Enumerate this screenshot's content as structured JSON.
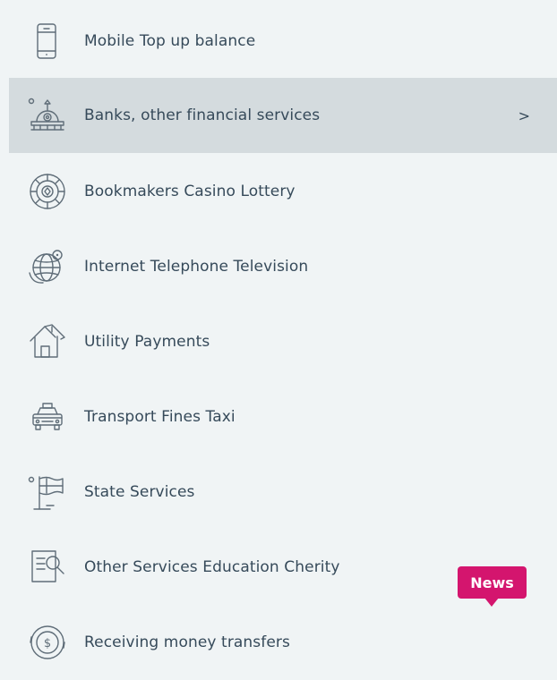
{
  "menu": {
    "items": [
      {
        "label": "Mobile Top up balance",
        "icon": "mobile-phone-icon"
      },
      {
        "label": "Banks, other financial services",
        "icon": "bank-icon",
        "selected": true,
        "chevron": ">"
      },
      {
        "label": "Bookmakers Casino Lottery",
        "icon": "casino-chip-icon"
      },
      {
        "label": "Internet Telephone Television",
        "icon": "globe-network-icon"
      },
      {
        "label": "Utility Payments",
        "icon": "house-icon"
      },
      {
        "label": "Transport Fines Taxi",
        "icon": "taxi-icon"
      },
      {
        "label": "State Services",
        "icon": "flag-icon"
      },
      {
        "label": "Other Services Education Cherity",
        "icon": "document-search-icon"
      },
      {
        "label": "Receiving money transfers",
        "icon": "money-transfer-icon"
      }
    ]
  },
  "badge": {
    "label": "News"
  },
  "colors": {
    "background": "#f0f4f5",
    "selected_row": "#d4dbde",
    "text": "#364a5a",
    "icon": "#5f6d78",
    "badge": "#d4156e"
  }
}
